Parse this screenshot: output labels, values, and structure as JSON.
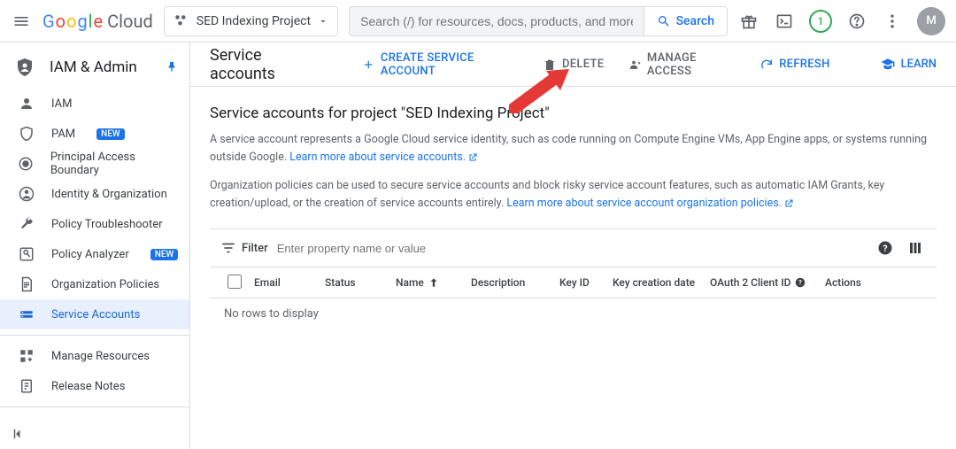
{
  "header": {
    "logo_text": "Google",
    "cloud_text": "Cloud",
    "project_name": "SED Indexing Project",
    "search_placeholder": "Search (/) for resources, docs, products, and more",
    "search_btn": "Search",
    "notif_count": "1",
    "avatar_letter": "M"
  },
  "sidebar": {
    "section_title": "IAM & Admin",
    "items": [
      {
        "label": "IAM",
        "icon": "user"
      },
      {
        "label": "PAM",
        "icon": "shield",
        "badge": "NEW"
      },
      {
        "label": "Principal Access Boundary",
        "icon": "boundary"
      },
      {
        "label": "Identity & Organization",
        "icon": "account"
      },
      {
        "label": "Policy Troubleshooter",
        "icon": "wrench"
      },
      {
        "label": "Policy Analyzer",
        "icon": "analyze",
        "badge": "NEW"
      },
      {
        "label": "Organization Policies",
        "icon": "doc"
      },
      {
        "label": "Service Accounts",
        "icon": "service",
        "active": true
      }
    ],
    "items2": [
      {
        "label": "Manage Resources",
        "icon": "resources"
      },
      {
        "label": "Release Notes",
        "icon": "notes"
      }
    ]
  },
  "toolbar": {
    "title": "Service accounts",
    "create": "CREATE SERVICE ACCOUNT",
    "delete": "DELETE",
    "manage": "MANAGE ACCESS",
    "refresh": "REFRESH",
    "learn": "LEARN"
  },
  "content": {
    "heading": "Service accounts for project \"SED Indexing Project\"",
    "desc1_a": "A service account represents a Google Cloud service identity, such as code running on Compute Engine VMs, App Engine apps, or systems running outside Google. ",
    "desc1_link": "Learn more about service accounts.",
    "desc2_a": "Organization policies can be used to secure service accounts and block risky service account features, such as automatic IAM Grants, key creation/upload, or the creation of service accounts entirely. ",
    "desc2_link": "Learn more about service account organization policies."
  },
  "table": {
    "filter_label": "Filter",
    "filter_placeholder": "Enter property name or value",
    "columns": {
      "email": "Email",
      "status": "Status",
      "name": "Name",
      "desc": "Description",
      "keyid": "Key ID",
      "kcd": "Key creation date",
      "oauth": "OAuth 2 Client ID",
      "actions": "Actions"
    },
    "no_rows": "No rows to display"
  }
}
